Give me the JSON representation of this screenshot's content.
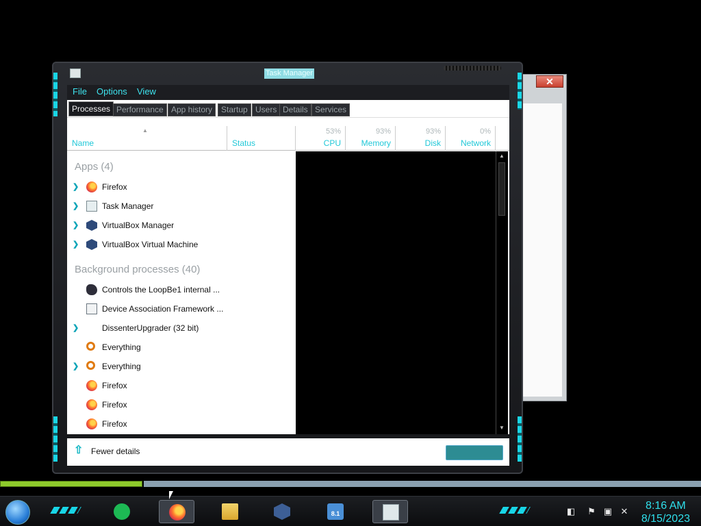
{
  "window": {
    "title": "Task Manager"
  },
  "menu": [
    "File",
    "Options",
    "View"
  ],
  "tabs": [
    "Processes",
    "Performance",
    "App history",
    "Startup",
    "Users",
    "Details",
    "Services"
  ],
  "columns": {
    "name": "Name",
    "status": "Status",
    "cpu": {
      "pct": "53%",
      "label": "CPU"
    },
    "memory": {
      "pct": "93%",
      "label": "Memory"
    },
    "disk": {
      "pct": "93%",
      "label": "Disk"
    },
    "network": {
      "pct": "0%",
      "label": "Network"
    }
  },
  "groups": {
    "apps": "Apps (4)",
    "background": "Background processes (40)"
  },
  "apps": [
    {
      "name": "Firefox",
      "icon": "firefox-icon",
      "expandable": true
    },
    {
      "name": "Task Manager",
      "icon": "task-manager-icon",
      "expandable": true
    },
    {
      "name": "VirtualBox Manager",
      "icon": "virtualbox-icon",
      "expandable": true
    },
    {
      "name": "VirtualBox Virtual Machine",
      "icon": "virtualbox-icon",
      "expandable": true
    }
  ],
  "background": [
    {
      "name": "Controls the LoopBe1 internal ...",
      "icon": "loopbe-icon",
      "expandable": false
    },
    {
      "name": "Device Association Framework ...",
      "icon": "device-icon",
      "expandable": false
    },
    {
      "name": "DissenterUpgrader (32 bit)",
      "icon": "dissenter-icon",
      "expandable": true
    },
    {
      "name": "Everything",
      "icon": "everything-icon",
      "expandable": false
    },
    {
      "name": "Everything",
      "icon": "everything-icon",
      "expandable": true
    },
    {
      "name": "Firefox",
      "icon": "firefox-icon",
      "expandable": false
    },
    {
      "name": "Firefox",
      "icon": "firefox-icon",
      "expandable": false
    },
    {
      "name": "Firefox",
      "icon": "firefox-icon",
      "expandable": false
    }
  ],
  "footer": {
    "fewer_details": "Fewer details"
  },
  "bg_window": {
    "close_glyph": "✕"
  },
  "taskbar": {
    "apps": [
      "spotify-icon",
      "firefox-icon",
      "file-explorer-icon",
      "virtualbox-icon",
      "windows-8-1-vm-icon",
      "task-manager-icon"
    ],
    "win81_badge": "8.1",
    "time": "8:16 AM",
    "date": "8/15/2023"
  },
  "colors": {
    "accent": "#21c8d8",
    "frame": "#1c1d21",
    "progress_green": "#8ecb2c"
  }
}
